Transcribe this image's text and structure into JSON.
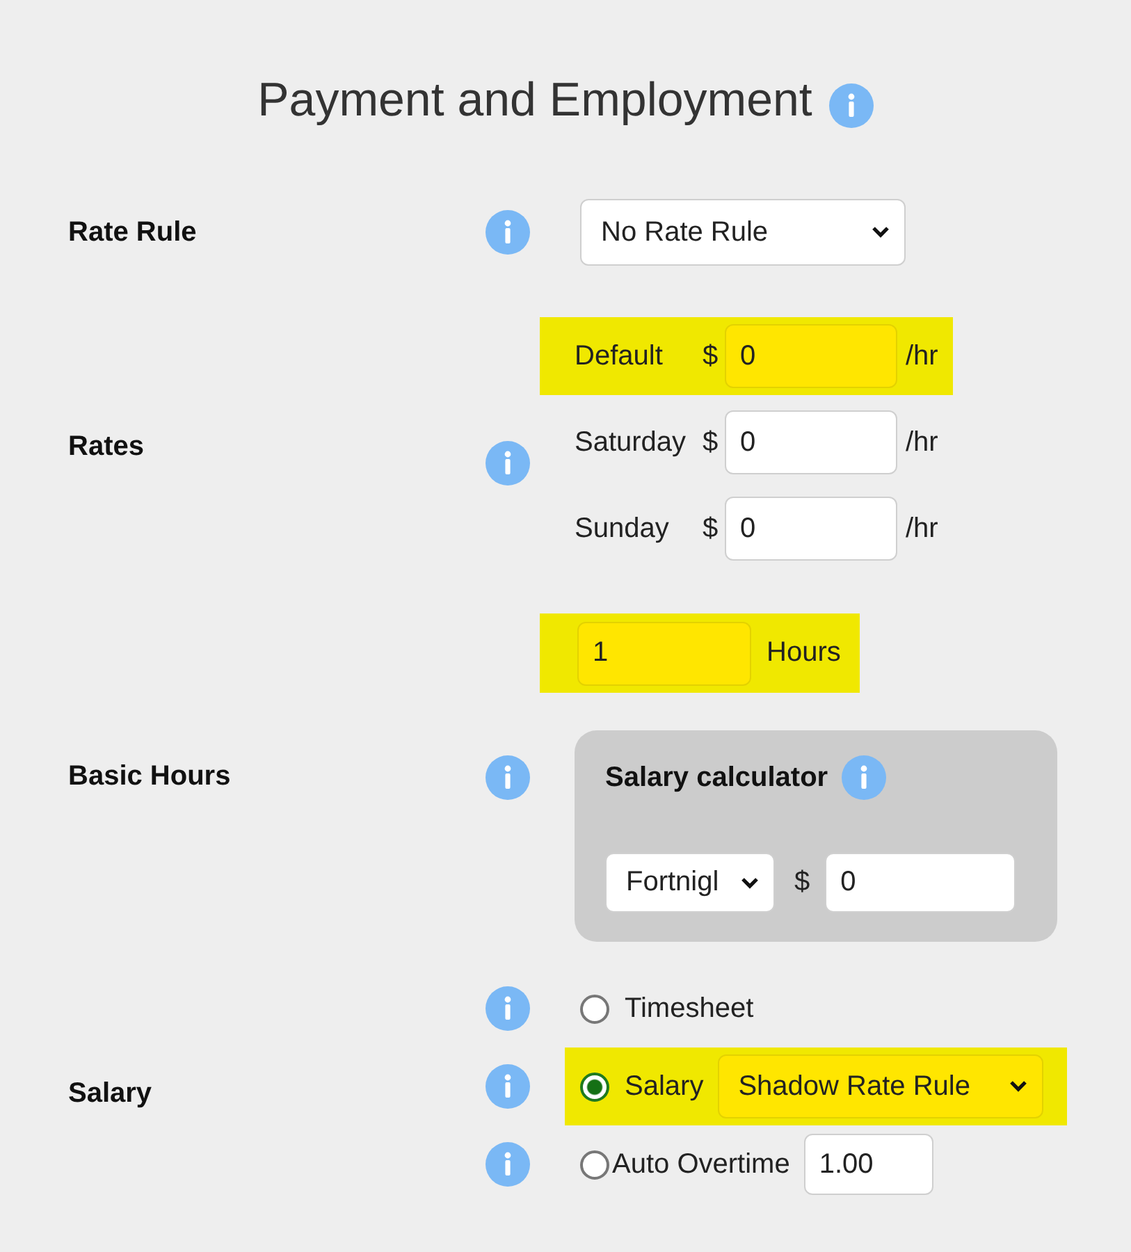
{
  "title": "Payment and Employment",
  "rate_rule": {
    "label": "Rate Rule",
    "value": "No Rate Rule"
  },
  "rates": {
    "label": "Rates",
    "items": [
      {
        "day": "Default",
        "currency": "$",
        "value": "0",
        "unit": "/hr",
        "highlighted": true
      },
      {
        "day": "Saturday",
        "currency": "$",
        "value": "0",
        "unit": "/hr",
        "highlighted": false
      },
      {
        "day": "Sunday",
        "currency": "$",
        "value": "0",
        "unit": "/hr",
        "highlighted": false
      }
    ]
  },
  "basic_hours": {
    "label": "Basic Hours",
    "hours": {
      "value": "1",
      "unit": "Hours",
      "highlighted": true
    },
    "calculator": {
      "title": "Salary calculator",
      "period": "Fortnigl",
      "currency": "$",
      "value": "0"
    }
  },
  "salary": {
    "label": "Salary",
    "options": [
      {
        "kind": "plain",
        "label": "Timesheet",
        "selected": false,
        "highlighted": false
      },
      {
        "kind": "dropdown",
        "label": "Salary",
        "value": "Shadow Rate Rule",
        "selected": true,
        "highlighted": true
      },
      {
        "kind": "number",
        "label": "Auto Overtime",
        "value": "1.00",
        "selected": false,
        "highlighted": false
      }
    ]
  }
}
